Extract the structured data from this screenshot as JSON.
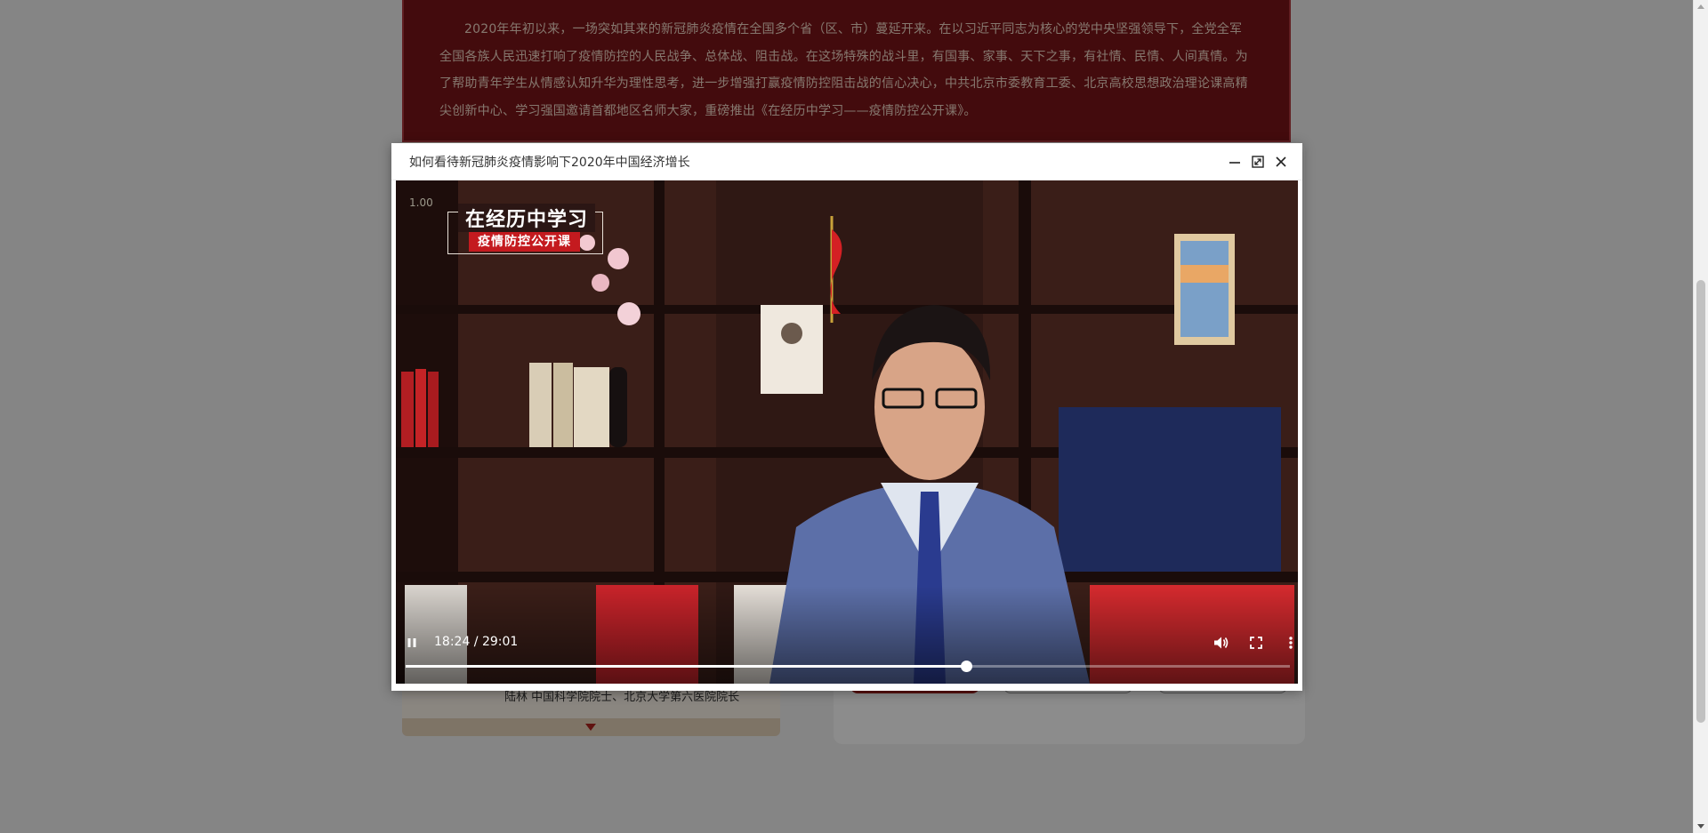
{
  "intro": {
    "text": "2020年年初以来，一场突如其来的新冠肺炎疫情在全国多个省（区、市）蔓延开来。在以习近平同志为核心的党中央坚强领导下，全党全军全国各族人民迅速打响了疫情防控的人民战争、总体战、阻击战。在这场特殊的战斗里，有国事、家事、天下之事，有社情、民情、人间真情。为了帮助青年学生从情感认知升华为理性思考，进一步增强打赢疫情防控阻击战的信心决心，中共北京市委教育工委、北京高校思想政治理论课高精尖创新中心、学习强国邀请首都地区名师大家，重磅推出《在经历中学习——疫情防控公开课》。"
  },
  "lecturer": {
    "text": "陆林   中国科学院院士、北京大学第六医院院长"
  },
  "modal": {
    "title": "如何看待新冠肺炎疫情影响下2020年中国经济增长",
    "minimize_icon": "minimize-icon",
    "maximize_icon": "maximize-icon",
    "close_icon": "close-icon"
  },
  "video": {
    "speed_overlay": "1.00",
    "course_logo_main": "在经历中学习",
    "course_logo_sub": "疫情防控公开课",
    "time_display": "18:24 / 29:01",
    "current_time": "18:24",
    "duration": "29:01",
    "progress_fraction": 0.634,
    "state": "playing"
  },
  "colors": {
    "intro_bg": "#7a1518",
    "accent_red": "#a3201c",
    "logo_red": "#c41a1f"
  }
}
